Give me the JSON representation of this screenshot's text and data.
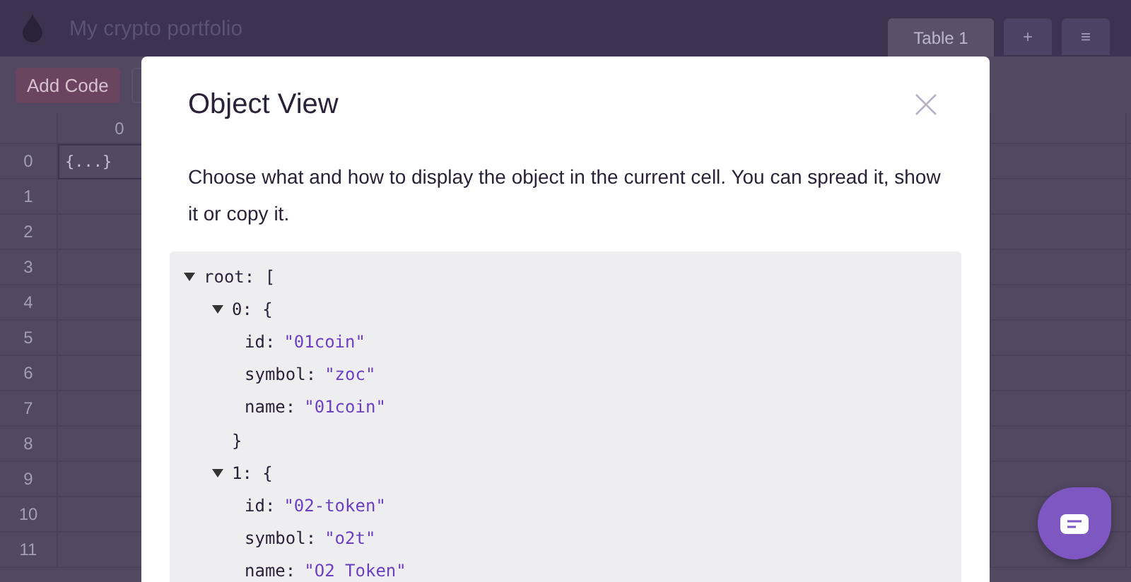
{
  "app": {
    "title": "My crypto portfolio",
    "tabs": [
      {
        "label": "Table 1",
        "selected": true
      },
      {
        "label": "+",
        "selected": false
      },
      {
        "label": "≡",
        "selected": false
      }
    ],
    "toolbar": {
      "add_button": "Add Code"
    },
    "grid": {
      "column_header": "0",
      "row_numbers": [
        "0",
        "1",
        "2",
        "3",
        "4",
        "5",
        "6",
        "7",
        "8",
        "9",
        "10",
        "11"
      ],
      "cell": "{...}"
    }
  },
  "modal": {
    "title": "Object View",
    "description": "Choose what and how to display the object in the current cell. You can spread it, show it or copy it.",
    "tree": {
      "label": "root: [",
      "expanded": true,
      "children": [
        {
          "label": "0: {",
          "expanded": true,
          "closing": "}",
          "children": [
            {
              "key": "id:",
              "value": "\"01coin\""
            },
            {
              "key": "symbol:",
              "value": "\"zoc\""
            },
            {
              "key": "name:",
              "value": "\"01coin\""
            }
          ]
        },
        {
          "label": "1: {",
          "expanded": true,
          "children": [
            {
              "key": "id:",
              "value": "\"02-token\""
            },
            {
              "key": "symbol:",
              "value": "\"o2t\""
            },
            {
              "key": "name:",
              "value": "\"O2 Token\""
            }
          ]
        }
      ]
    }
  }
}
